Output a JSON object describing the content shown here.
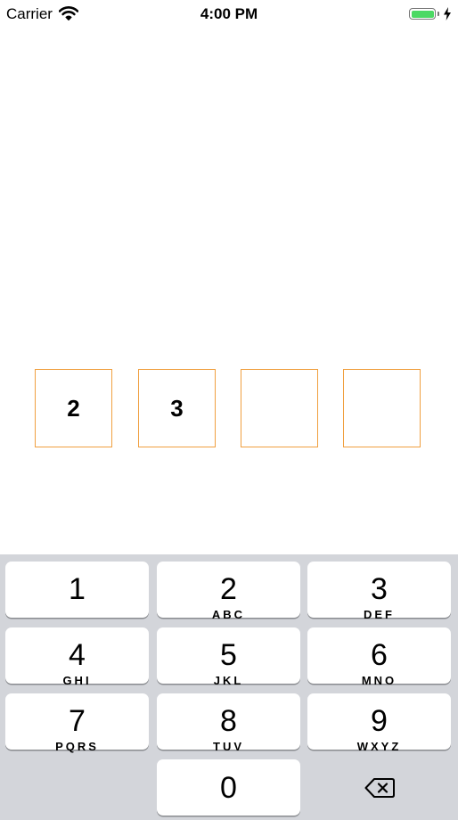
{
  "status_bar": {
    "carrier": "Carrier",
    "time": "4:00 PM",
    "wifi_icon": "wifi-icon",
    "battery_icon": "battery-icon",
    "battery_level": 1.0,
    "charging_icon": "bolt-icon"
  },
  "pin": {
    "digits": [
      "2",
      "3",
      "",
      ""
    ],
    "box_border_color": "#f0a040"
  },
  "keypad": {
    "keys": [
      {
        "digit": "1",
        "letters": ""
      },
      {
        "digit": "2",
        "letters": "ABC"
      },
      {
        "digit": "3",
        "letters": "DEF"
      },
      {
        "digit": "4",
        "letters": "GHI"
      },
      {
        "digit": "5",
        "letters": "JKL"
      },
      {
        "digit": "6",
        "letters": "MNO"
      },
      {
        "digit": "7",
        "letters": "PQRS"
      },
      {
        "digit": "8",
        "letters": "TUV"
      },
      {
        "digit": "9",
        "letters": "WXYZ"
      },
      {
        "digit": "0",
        "letters": ""
      }
    ],
    "delete_icon": "backspace-icon",
    "background_color": "#d3d5da"
  }
}
